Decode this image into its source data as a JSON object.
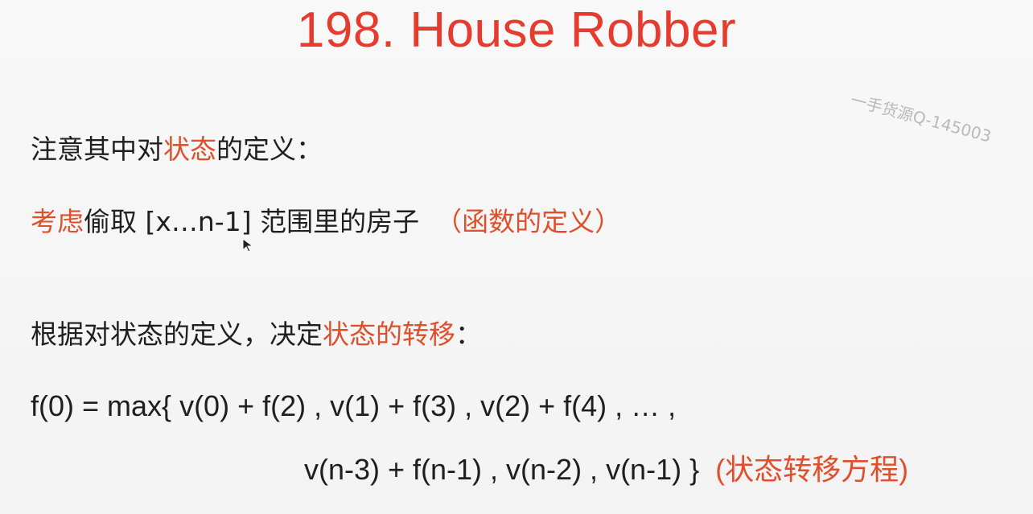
{
  "slide": {
    "title": "198. House Robber",
    "watermark": "一手货源Q-145003",
    "line1": {
      "a": "注意其中对",
      "b": "状态",
      "c": "的定义："
    },
    "line2": {
      "a": "考虑",
      "b": "偷取 [x…n-1] 范围里的房子",
      "c": "（函数的定义）"
    },
    "line3": {
      "a": "根据对状态的定义，决定",
      "b": "状态的转移",
      "c": "："
    },
    "formula1": "f(0) = max{ v(0) + f(2) , v(1) + f(3) , v(2) + f(4) , … ,",
    "formula2": {
      "expression": "v(n-3) + f(n-1) , v(n-2) , v(n-1) }",
      "label": "(状态转移方程)"
    }
  },
  "colors": {
    "title": "#e53c2f",
    "accent": "#e04f2b",
    "text": "#1f1f1f",
    "background": "#f6f6f6",
    "watermark": "#b9b9b9"
  },
  "icons": {
    "cursor": "mouse-cursor-icon"
  }
}
